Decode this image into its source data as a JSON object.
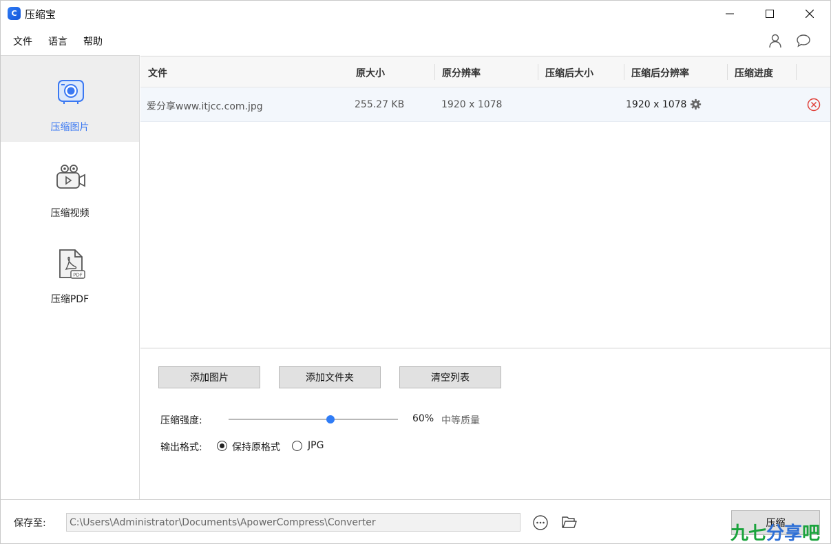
{
  "app": {
    "title": "压缩宝"
  },
  "menu": {
    "file": "文件",
    "language": "语言",
    "help": "帮助"
  },
  "sidebar": {
    "items": [
      {
        "label": "压缩图片",
        "icon": "camera-icon",
        "active": true
      },
      {
        "label": "压缩视频",
        "icon": "video-camera-icon",
        "active": false
      },
      {
        "label": "压缩PDF",
        "icon": "pdf-file-icon",
        "active": false
      }
    ]
  },
  "table": {
    "columns": [
      "文件",
      "原大小",
      "原分辨率",
      "压缩后大小",
      "压缩后分辨率",
      "压缩进度"
    ],
    "rows": [
      {
        "file": "爱分享www.itjcc.com.jpg",
        "size": "255.27 KB",
        "resolution": "1920 x 1078",
        "compressed_size": "",
        "compressed_resolution": "1920 x 1078",
        "progress": ""
      }
    ]
  },
  "controls": {
    "add_images": "添加图片",
    "add_folder": "添加文件夹",
    "clear_list": "清空列表",
    "strength_label": "压缩强度:",
    "strength_value": 60,
    "strength_percent": "60%",
    "strength_quality": "中等质量",
    "format_label": "输出格式:",
    "format_options": [
      "保持原格式",
      "JPG"
    ],
    "format_selected": "保持原格式"
  },
  "footer": {
    "save_label": "保存至:",
    "save_path": "C:\\Users\\Administrator\\Documents\\ApowerCompress\\Converter",
    "compress_button": "压缩"
  },
  "watermark": {
    "part1": "九七",
    "part2": "分享",
    "part3": "吧"
  },
  "colors": {
    "accent": "#3a78f2",
    "slider_thumb": "#2f7cf6",
    "remove_icon": "#e0413a"
  }
}
